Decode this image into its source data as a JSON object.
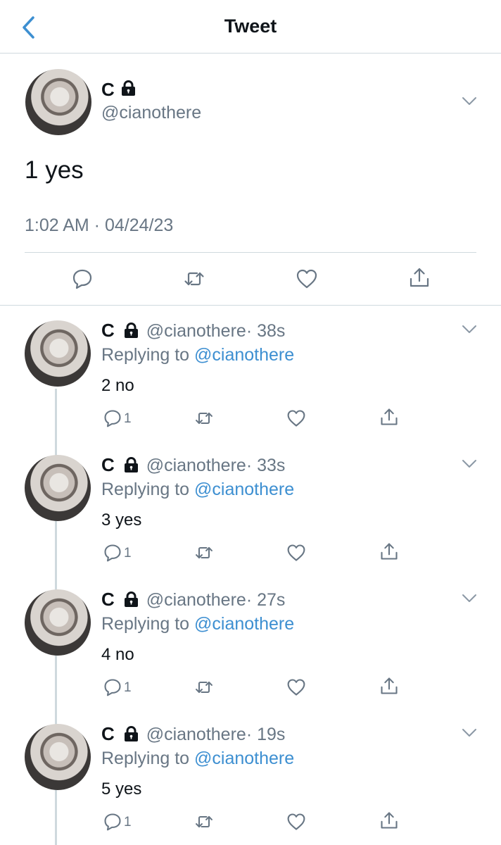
{
  "header": {
    "title": "Tweet",
    "back_icon": "chevron-left-icon"
  },
  "main_tweet": {
    "name": "C",
    "handle": "@cianothere",
    "text": "1 yes",
    "timestamp": "1:02 AM · 04/24/23"
  },
  "replies": [
    {
      "name": "C",
      "handle": "@cianothere",
      "time": "· 38s",
      "replying_prefix": "Replying to ",
      "replying_to": "@cianothere",
      "text": "2 no",
      "reply_count": "1"
    },
    {
      "name": "C",
      "handle": "@cianothere",
      "time": "· 33s",
      "replying_prefix": "Replying to ",
      "replying_to": "@cianothere",
      "text": "3 yes",
      "reply_count": "1"
    },
    {
      "name": "C",
      "handle": "@cianothere",
      "time": "· 27s",
      "replying_prefix": "Replying to ",
      "replying_to": "@cianothere",
      "text": "4 no",
      "reply_count": "1"
    },
    {
      "name": "C",
      "handle": "@cianothere",
      "time": "· 19s",
      "replying_prefix": "Replying to ",
      "replying_to": "@cianothere",
      "text": "5 yes",
      "reply_count": "1"
    }
  ],
  "colors": {
    "link": "#3d8fd1",
    "secondary_text": "#687684",
    "divider": "#cfd9de"
  }
}
